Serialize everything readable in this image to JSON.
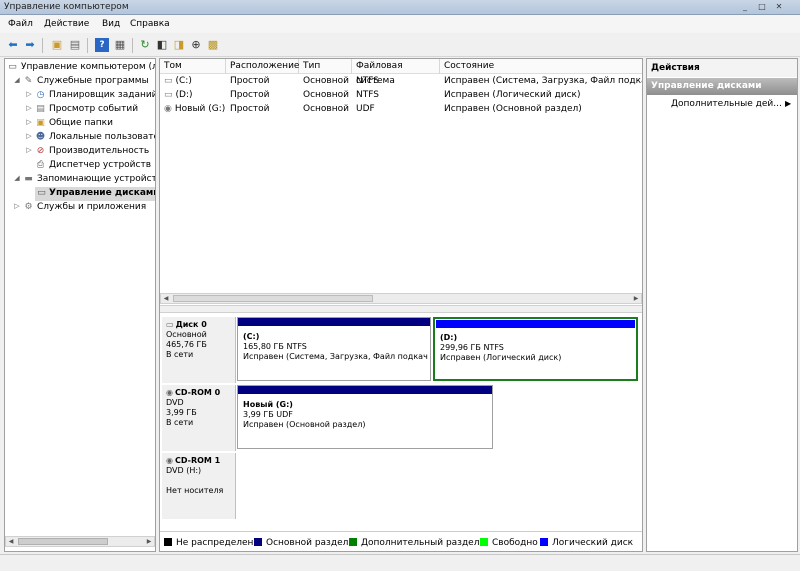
{
  "window": {
    "title": "Управление компьютером",
    "controls": [
      "_",
      "□",
      "✕"
    ]
  },
  "menu": [
    "Файл",
    "Действие",
    "Вид",
    "Справка"
  ],
  "toolbar": {
    "icons": [
      "back-icon",
      "forward-icon",
      "up-folder-icon",
      "console-tree-icon",
      "help-icon",
      "properties-icon",
      "refresh-icon",
      "folder-icon",
      "open-folder-icon",
      "search-icon",
      "disk-settings-icon"
    ]
  },
  "tree": {
    "root": "Управление компьютером (л",
    "items": [
      {
        "label": "Служебные программы"
      },
      {
        "label": "Планировщик заданий"
      },
      {
        "label": "Просмотр событий"
      },
      {
        "label": "Общие папки"
      },
      {
        "label": "Локальные пользовате"
      },
      {
        "label": "Производительность"
      },
      {
        "label": "Диспетчер устройств"
      },
      {
        "label": "Запоминающие устройств"
      },
      {
        "label": "Управление дисками"
      },
      {
        "label": "Службы и приложения"
      }
    ]
  },
  "volumes": {
    "columns": [
      "Том",
      "Расположение",
      "Тип",
      "Файловая система",
      "Состояние"
    ],
    "rows": [
      {
        "tom": "(C:)",
        "loc": "Простой",
        "type": "Основной",
        "fs": "NTFS",
        "state": "Исправен (Система, Загрузка, Файл подкачки,"
      },
      {
        "tom": "(D:)",
        "loc": "Простой",
        "type": "Основной",
        "fs": "NTFS",
        "state": "Исправен (Логический диск)"
      },
      {
        "tom": "Новый (G:)",
        "loc": "Простой",
        "type": "Основной",
        "fs": "UDF",
        "state": "Исправен (Основной раздел)"
      }
    ]
  },
  "disks": [
    {
      "name": "Диск 0",
      "kind": "Основной",
      "size": "465,76 ГБ",
      "status": "В сети",
      "parts": [
        {
          "name": "(C:)",
          "size": "165,80 ГБ NTFS",
          "state": "Исправен (Система, Загрузка, Файл подкач"
        },
        {
          "name": "(D:)",
          "size": "299,96 ГБ NTFS",
          "state": "Исправен (Логический диск)"
        }
      ]
    },
    {
      "name": "CD-ROM 0",
      "kind": "DVD",
      "size": "3,99 ГБ",
      "status": "В сети",
      "parts": [
        {
          "name": "Новый  (G:)",
          "size": "3,99 ГБ UDF",
          "state": "Исправен (Основной раздел)"
        }
      ]
    },
    {
      "name": "CD-ROM 1",
      "kind": "DVD (H:)",
      "size": "",
      "status": "Нет носителя",
      "parts": []
    }
  ],
  "legend": [
    {
      "label": "Не распределен",
      "color": "#000000"
    },
    {
      "label": "Основной раздел",
      "color": "#000080"
    },
    {
      "label": "Дополнительный раздел",
      "color": "#008000"
    },
    {
      "label": "Свободно",
      "color": "#00ff00"
    },
    {
      "label": "Логический диск",
      "color": "#0000ff"
    }
  ],
  "actions": {
    "title": "Действия",
    "section": "Управление дисками",
    "item": "Дополнительные дей..."
  }
}
